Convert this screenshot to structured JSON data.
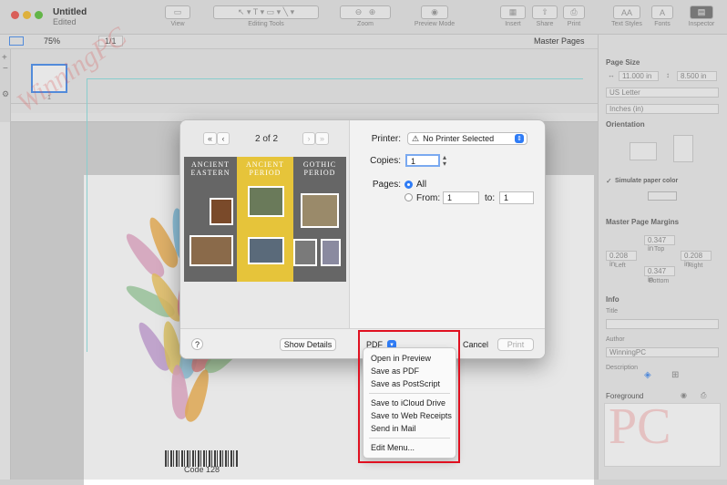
{
  "window": {
    "title": "Untitled",
    "subtitle": "Edited"
  },
  "toolbar": {
    "items": [
      {
        "label": "View"
      },
      {
        "label": "Editing Tools"
      },
      {
        "label": "Zoom"
      },
      {
        "label": "Preview Mode"
      },
      {
        "label": "Insert"
      },
      {
        "label": "Share"
      },
      {
        "label": "Print"
      },
      {
        "label": "Text Styles"
      },
      {
        "label": "Fonts"
      },
      {
        "label": "Inspector"
      }
    ]
  },
  "subbar": {
    "zoom": "75%",
    "page_counter": "1/1",
    "master_pages": "Master Pages"
  },
  "thumbnail": {
    "number": "1"
  },
  "canvas": {
    "barcode_label": "Code 128"
  },
  "inspector": {
    "page_size_heading": "Page Size",
    "width": "11.000 in",
    "height": "8.500 in",
    "paper": "US Letter",
    "units": "Inches (in)",
    "orientation_heading": "Orientation",
    "simulate_paper_color": "Simulate paper color",
    "margins_heading": "Master Page Margins",
    "margin_top": "0.347 in",
    "margin_top_label": "Top",
    "margin_left": "0.208 in",
    "margin_left_label": "Left",
    "margin_right": "0.208 in",
    "margin_right_label": "Right",
    "margin_bottom": "0.347 in",
    "margin_bottom_label": "Bottom",
    "info_heading": "Info",
    "title_label": "Title",
    "author_label": "Author",
    "author_value": "WinningPC",
    "description_label": "Description",
    "layer_name": "Foreground"
  },
  "dialog": {
    "page_indicator": "2 of 2",
    "preview_columns": [
      {
        "title": "ANCIENT EASTERN"
      },
      {
        "title": "ANCIENT PERIOD"
      },
      {
        "title": "GOTHIC PERIOD"
      }
    ],
    "printer_label": "Printer:",
    "printer_value": "No Printer Selected",
    "copies_label": "Copies:",
    "copies_value": "1",
    "pages_label": "Pages:",
    "pages_all": "All",
    "pages_from": "From:",
    "from_value": "1",
    "to_label": "to:",
    "to_value": "1",
    "help": "?",
    "show_details": "Show Details",
    "pdf": "PDF",
    "cancel": "Cancel",
    "print": "Print"
  },
  "pdf_menu": {
    "items": [
      "Open in Preview",
      "Save as PDF",
      "Save as PostScript",
      "Save to iCloud Drive",
      "Save to Web Receipts",
      "Send in Mail",
      "Edit Menu..."
    ]
  },
  "watermark": {
    "text": "WinningPC",
    "logo_text": "PC"
  },
  "colors": {
    "accent": "#2f7cf6",
    "highlight_box": "#e01020",
    "preview_yellow": "#e6c43a"
  }
}
